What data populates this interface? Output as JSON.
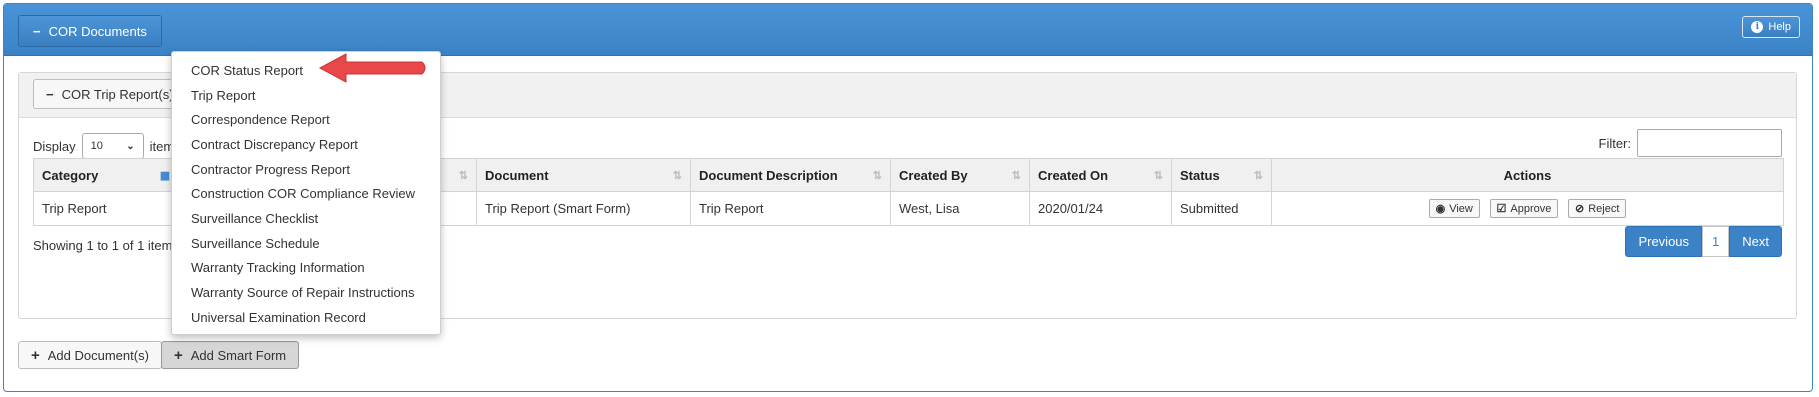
{
  "header": {
    "title": "COR Documents",
    "help_label": "Help"
  },
  "inner": {
    "title": "COR Trip Report(s)"
  },
  "display": {
    "label_before": "Display",
    "value": "10",
    "label_after": "items"
  },
  "filter": {
    "label": "Filter:",
    "value": ""
  },
  "table": {
    "columns": [
      "Category",
      "",
      "Document",
      "Document Description",
      "Created By",
      "Created On",
      "Status",
      "Actions"
    ],
    "rows": [
      {
        "category": "Trip Report",
        "col2": "",
        "document": "Trip Report (Smart Form)",
        "description": "Trip Report",
        "created_by": "West, Lisa",
        "created_on": "2020/01/24",
        "status": "Submitted"
      }
    ],
    "actions": [
      "View",
      "Approve",
      "Reject"
    ]
  },
  "showing_text": "Showing 1 to 1 of 1 items",
  "pager": {
    "previous": "Previous",
    "page": "1",
    "next": "Next"
  },
  "buttons": {
    "add_documents": "Add Document(s)",
    "add_smart_form": "Add Smart Form"
  },
  "dropdown": {
    "items": [
      "COR Status Report",
      "Trip Report",
      "Correspondence Report",
      "Contract Discrepancy Report",
      "Contractor Progress Report",
      "Construction COR Compliance Review",
      "Surveillance Checklist",
      "Surveillance Schedule",
      "Warranty Tracking Information",
      "Warranty Source of Repair Instructions",
      "Universal Examination Record"
    ]
  },
  "colors": {
    "primary": "#3b83c6",
    "header_border": "#2f72b3",
    "arrow": "#e8484a"
  },
  "icons": {
    "minus": "minus-icon",
    "info": "info-icon",
    "plus": "plus-icon",
    "view": "eye-icon",
    "approve": "check-square-icon",
    "reject": "ban-icon"
  }
}
